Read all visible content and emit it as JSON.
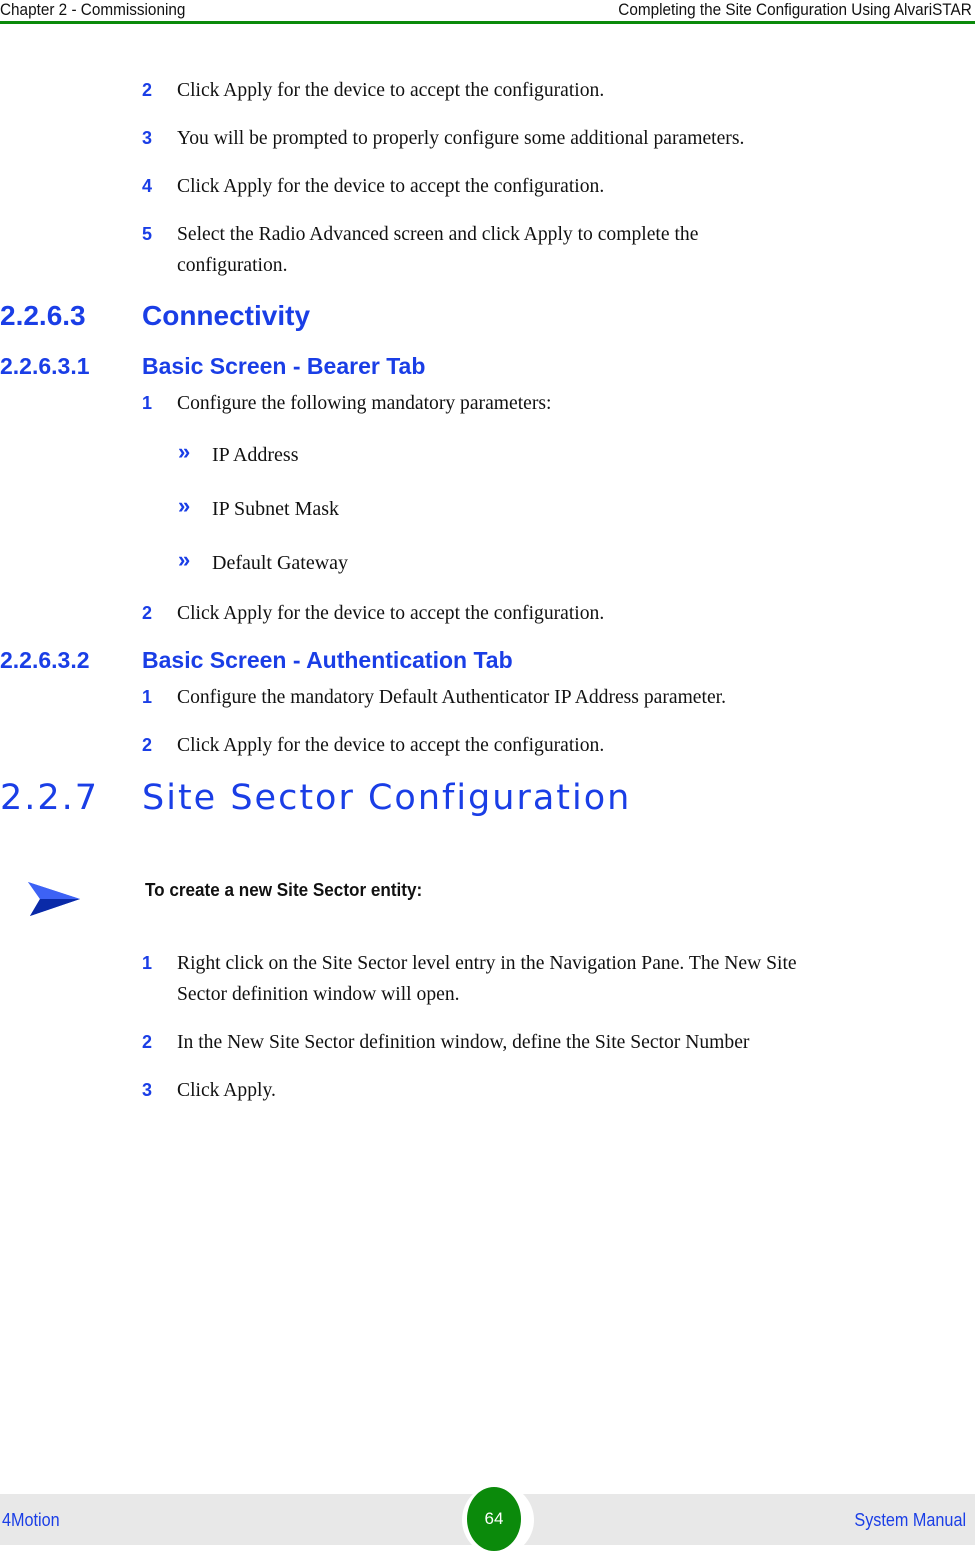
{
  "header": {
    "chapter": "Chapter 2 - Commissioning",
    "section": "Completing the Site Configuration Using AlvariSTAR"
  },
  "intro_steps": [
    {
      "num": "2",
      "text": "Click Apply for the device to accept the configuration."
    },
    {
      "num": "3",
      "text": "You will be prompted to properly configure some additional parameters."
    },
    {
      "num": "4",
      "text": "Click Apply for the device to accept the configuration."
    },
    {
      "num": "5",
      "text": "Select the Radio Advanced screen and click Apply to complete the",
      "text2": "configuration."
    }
  ],
  "connectivity": {
    "number": "2.2.6.3",
    "title": "Connectivity",
    "bearer_tab": {
      "number": "2.2.6.3.1",
      "title": "Basic Screen - Bearer Tab",
      "step1": {
        "num": "1",
        "text": "Configure the following mandatory parameters:"
      },
      "bullets": [
        {
          "marker": "»",
          "text": "IP Address"
        },
        {
          "marker": "»",
          "text": "IP Subnet Mask"
        },
        {
          "marker": "»",
          "text": "Default Gateway"
        }
      ],
      "step2": {
        "num": "2",
        "text": "Click Apply for the device to accept the configuration."
      }
    },
    "auth_tab": {
      "number": "2.2.6.3.2",
      "title": "Basic Screen - Authentication Tab",
      "steps": [
        {
          "num": "1",
          "text": "Configure the mandatory Default Authenticator IP Address parameter."
        },
        {
          "num": "2",
          "text": "Click Apply for the device to accept the configuration."
        }
      ]
    }
  },
  "site_sector": {
    "number": "2.2.7",
    "title": "Site Sector Configuration",
    "procedure_label": "To create a new Site Sector entity:",
    "steps": [
      {
        "num": "1",
        "text": "Right click on the Site Sector level entry in the Navigation Pane. The New Site",
        "text2": "Sector definition window will open."
      },
      {
        "num": "2",
        "text": "In the New Site Sector definition window, define the Site Sector Number"
      },
      {
        "num": "3",
        "text": "Click Apply."
      }
    ]
  },
  "footer": {
    "product": "4Motion",
    "page": "64",
    "doc": "System Manual"
  }
}
